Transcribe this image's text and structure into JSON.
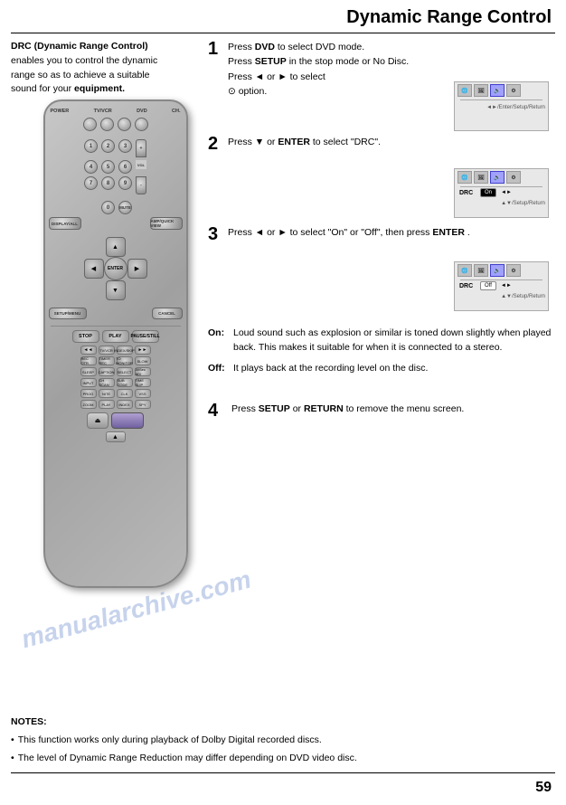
{
  "header": {
    "title": "Dynamic Range Control"
  },
  "intro": {
    "text": "DRC (Dynamic Range Control) enables you to control the dynamic range so as to achieve a suitable sound for your equipment."
  },
  "steps": [
    {
      "num": "1",
      "lines": [
        {
          "text": "Press ",
          "parts": [
            {
              "t": "Press ",
              "b": false
            },
            {
              "t": "DVD",
              "b": true
            },
            {
              "t": " to select DVD mode.",
              "b": false
            }
          ]
        },
        {
          "parts": [
            {
              "t": "Press ",
              "b": false
            },
            {
              "t": "SETUP",
              "b": true
            },
            {
              "t": " in the stop mode or No Disc.",
              "b": false
            }
          ]
        },
        {
          "parts": [
            {
              "t": "Press ",
              "b": false
            },
            {
              "t": "◄",
              "b": false
            },
            {
              "t": " or ",
              "b": false
            },
            {
              "t": "►",
              "b": false
            },
            {
              "t": " to select",
              "b": false
            }
          ]
        },
        {
          "parts": [
            {
              "t": "⊙ option.",
              "b": false
            }
          ]
        }
      ]
    },
    {
      "num": "2",
      "lines": [
        {
          "parts": [
            {
              "t": "Press ",
              "b": false
            },
            {
              "t": "▼",
              "b": false
            },
            {
              "t": " or ",
              "b": false
            },
            {
              "t": "ENTER",
              "b": true
            },
            {
              "t": " to select \"DRC\".",
              "b": false
            }
          ]
        }
      ]
    },
    {
      "num": "3",
      "lines": [
        {
          "parts": [
            {
              "t": "Press ",
              "b": false
            },
            {
              "t": "◄",
              "b": false
            },
            {
              "t": " or ",
              "b": false
            },
            {
              "t": "►",
              "b": false
            },
            {
              "t": " to select",
              "b": false
            }
          ]
        },
        {
          "parts": [
            {
              "t": "\"On\" or \"Off\", then press",
              "b": false
            }
          ]
        },
        {
          "parts": [
            {
              "t": "ENTER",
              "b": true
            },
            {
              "t": " .",
              "b": false
            }
          ]
        }
      ]
    }
  ],
  "onoff": {
    "on_label": "On:",
    "on_text": "Loud sound such as explosion or similar is toned down slightly when played back. This makes it suitable for when it is connected to a stereo.",
    "off_label": "Off:",
    "off_text": "It plays back at the recording level on the disc."
  },
  "step4": {
    "num": "4",
    "text_parts": [
      {
        "t": "Press ",
        "b": false
      },
      {
        "t": "SETUP",
        "b": true
      },
      {
        "t": " or ",
        "b": false
      },
      {
        "t": "RETURN",
        "b": true
      },
      {
        "t": " to remove the menu screen.",
        "b": false
      }
    ]
  },
  "notes": {
    "title": "NOTES:",
    "items": [
      "This function works only during playback of Dolby Digital recorded discs.",
      "The level of Dynamic Range Reduction may differ depending on DVD video disc."
    ]
  },
  "page_number": "59",
  "thumbs": [
    {
      "id": "thumb1",
      "nav_label": "◄►/Enter/Setup/Return",
      "icons": [
        "globe",
        "image",
        "audio",
        "settings"
      ],
      "selected_icon": 2,
      "show_drc": false
    },
    {
      "id": "thumb2",
      "nav_label": "▲▼/Setup/Return",
      "icons": [
        "globe",
        "image",
        "audio",
        "settings"
      ],
      "selected_icon": 2,
      "show_drc": true,
      "drc_value": "On",
      "drc_highlighted": false
    },
    {
      "id": "thumb3",
      "nav_label": "▲▼/Setup/Return",
      "icons": [
        "globe",
        "image",
        "audio",
        "settings"
      ],
      "selected_icon": 2,
      "show_drc": true,
      "drc_value": "Off",
      "drc_highlighted": true
    }
  ],
  "watermark": "manualarchive.com"
}
